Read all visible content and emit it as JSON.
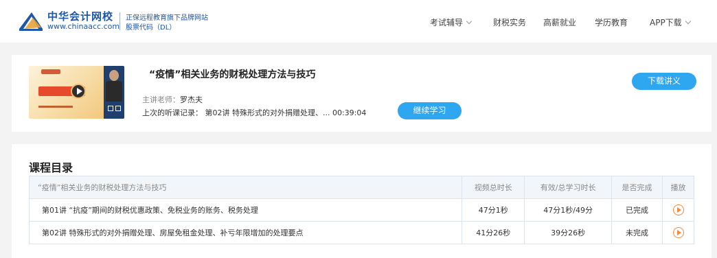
{
  "header": {
    "logo_cn": "中华会计网校",
    "logo_url": "www.chinaacc.com",
    "tagline": "正保远程教育旗下品牌网站",
    "stock_code": "股票代码（DL）",
    "nav": [
      {
        "label": "考试辅导",
        "has_dropdown": true
      },
      {
        "label": "财税实务",
        "has_dropdown": false
      },
      {
        "label": "高薪就业",
        "has_dropdown": false
      },
      {
        "label": "学历教育",
        "has_dropdown": false
      },
      {
        "label": "APP下载",
        "has_dropdown": true
      }
    ]
  },
  "course": {
    "title": "“疫情”相关业务的财税处理方法与技巧",
    "teacher_label": "主讲老师：",
    "teacher_name": "罗杰夫",
    "history": "上次的听课记录：  第02讲    特殊形式的对外捐赠处理、... 00:39:04",
    "continue_label": "继续学习",
    "download_label": "下载讲义"
  },
  "catalog": {
    "title": "课程目录",
    "columns": [
      "“疫情”相关业务的财税处理方法与技巧",
      "视频总时长",
      "有效/总学习时长",
      "是否完成",
      "播放"
    ],
    "rows": [
      {
        "title": "第01讲    “抗疫”期间的财税优惠政策、免税业务的账务、税务处理",
        "duration": "47分1秒",
        "study": "47分1秒/49分",
        "status": "已完成",
        "done": true
      },
      {
        "title": "第02讲    特殊形式的对外捐赠处理、房屋免租金处理、补亏年限增加的处理要点",
        "duration": "41分26秒",
        "study": "39分26秒",
        "status": "未完成",
        "done": false
      }
    ]
  },
  "colors": {
    "accent": "#2ea6f0",
    "brand": "#1e57a8",
    "done": "#2a9b3a",
    "undone": "#e0302a",
    "play": "#f08a3c"
  }
}
